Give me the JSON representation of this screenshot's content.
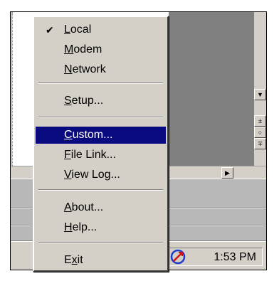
{
  "menu": {
    "items": [
      {
        "underline": "L",
        "rest": "ocal",
        "checked": true
      },
      {
        "underline": "M",
        "rest": "odem"
      },
      {
        "underline": "N",
        "rest": "etwork"
      },
      {
        "underline": "S",
        "rest": "etup..."
      },
      {
        "underline": "C",
        "rest": "ustom...",
        "selected": true
      },
      {
        "underline": "F",
        "rest": "ile Link..."
      },
      {
        "underline": "V",
        "rest": "iew Log..."
      },
      {
        "underline": "A",
        "rest": "bout..."
      },
      {
        "underline": "H",
        "rest": "elp..."
      },
      {
        "pre": "E",
        "underline": "x",
        "rest": "it"
      }
    ],
    "check_glyph": "✔"
  },
  "scrollbar": {
    "down_arrow": "▼",
    "up_step": "±",
    "circle": "○",
    "down_step": "∓",
    "right_arrow": "▶"
  },
  "tray": {
    "time": "1:53 PM",
    "icon": "network-status-icon"
  },
  "colors": {
    "selection": "#0a0a80",
    "menu_face": "#d4d0c8",
    "dark_panel": "#808080"
  }
}
